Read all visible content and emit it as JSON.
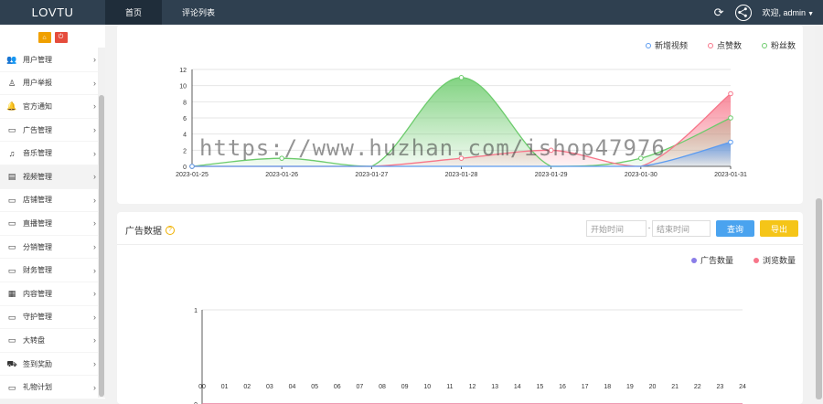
{
  "header": {
    "logo": "LOVTU",
    "tabs": [
      {
        "label": "首页"
      },
      {
        "label": "评论列表"
      }
    ],
    "user_label": "欢迎, admin"
  },
  "sidebar": {
    "home_btn": "⌂",
    "exit_btn": "⏻",
    "items": [
      {
        "label": "用户管理",
        "icon": "users-icon"
      },
      {
        "label": "用户举报",
        "icon": "user-report-icon"
      },
      {
        "label": "官方通知",
        "icon": "bell-icon"
      },
      {
        "label": "广告管理",
        "icon": "monitor-icon"
      },
      {
        "label": "音乐管理",
        "icon": "music-icon"
      },
      {
        "label": "视频管理",
        "icon": "video-icon"
      },
      {
        "label": "店铺管理",
        "icon": "monitor-icon"
      },
      {
        "label": "直播管理",
        "icon": "monitor-icon"
      },
      {
        "label": "分销管理",
        "icon": "monitor-icon"
      },
      {
        "label": "财务管理",
        "icon": "monitor-icon"
      },
      {
        "label": "内容管理",
        "icon": "grid-icon"
      },
      {
        "label": "守护管理",
        "icon": "monitor-icon"
      },
      {
        "label": "大转盘",
        "icon": "monitor-icon"
      },
      {
        "label": "签到奖励",
        "icon": "car-icon"
      },
      {
        "label": "礼物计划",
        "icon": "monitor-icon"
      }
    ]
  },
  "panel2": {
    "title": "广告数据",
    "start_placeholder": "开始时间",
    "range_sep": "-",
    "end_placeholder": "结束时间",
    "query_label": "查询",
    "export_label": "导出"
  },
  "watermark": "https://www.huzhan.com/ishop47976",
  "chart_data": [
    {
      "type": "area",
      "categories": [
        "2023-01-25",
        "2023-01-26",
        "2023-01-27",
        "2023-01-28",
        "2023-01-29",
        "2023-01-30",
        "2023-01-31"
      ],
      "ylim": [
        0,
        12
      ],
      "yticks": [
        0,
        2,
        4,
        6,
        8,
        10,
        12
      ],
      "legend_position": "top-right",
      "series": [
        {
          "name": "新增视频",
          "values": [
            0,
            0,
            0,
            0,
            0,
            0,
            3
          ],
          "color": "#5b9bf0"
        },
        {
          "name": "点赞数",
          "values": [
            0,
            0,
            0,
            1,
            2,
            0,
            9
          ],
          "color": "#f7768a"
        },
        {
          "name": "粉丝数",
          "values": [
            0,
            1,
            0,
            11,
            0,
            1,
            6
          ],
          "color": "#6ccb6c"
        }
      ]
    },
    {
      "type": "line",
      "categories": [
        "00",
        "01",
        "02",
        "03",
        "04",
        "05",
        "06",
        "07",
        "08",
        "09",
        "10",
        "11",
        "12",
        "13",
        "14",
        "15",
        "16",
        "17",
        "18",
        "19",
        "20",
        "21",
        "22",
        "23",
        "24"
      ],
      "ylim": [
        0,
        1
      ],
      "yticks": [
        0,
        1
      ],
      "legend_position": "top-right",
      "series": [
        {
          "name": "广告数量",
          "values": [
            0,
            0,
            0,
            0,
            0,
            0,
            0,
            0,
            0,
            0,
            0,
            0,
            0,
            0,
            0,
            0,
            0,
            0,
            0,
            0,
            0,
            0,
            0,
            0,
            0
          ],
          "color": "#8a7de8"
        },
        {
          "name": "浏览数量",
          "values": [
            0,
            0,
            0,
            0,
            0,
            0,
            0,
            0,
            0,
            0,
            0,
            0,
            0,
            0,
            0,
            0,
            0,
            0,
            0,
            0,
            0,
            0,
            0,
            0,
            0
          ],
          "color": "#f7768a"
        }
      ]
    }
  ]
}
